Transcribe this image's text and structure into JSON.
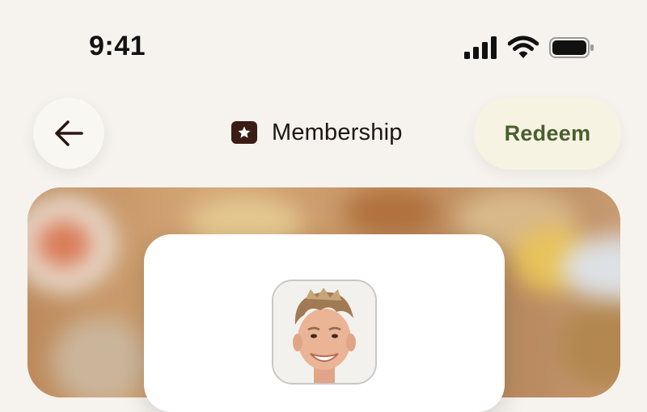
{
  "status_bar": {
    "time": "9:41",
    "icons": [
      "cellular-signal-icon",
      "wifi-icon",
      "battery-icon"
    ]
  },
  "nav": {
    "back_icon": "arrow-left-icon",
    "title": "Membership",
    "title_icon": "star-badge-icon",
    "redeem_label": "Redeem"
  },
  "colors": {
    "background": "#f6f3ee",
    "accent_dark": "#3b1d16",
    "redeem_text": "#4a5e2f",
    "redeem_bg": "#f6f3e3",
    "card": "#ffffff"
  },
  "hero": {
    "background": "blurred-food-photo",
    "avatar": "profile-photo"
  }
}
